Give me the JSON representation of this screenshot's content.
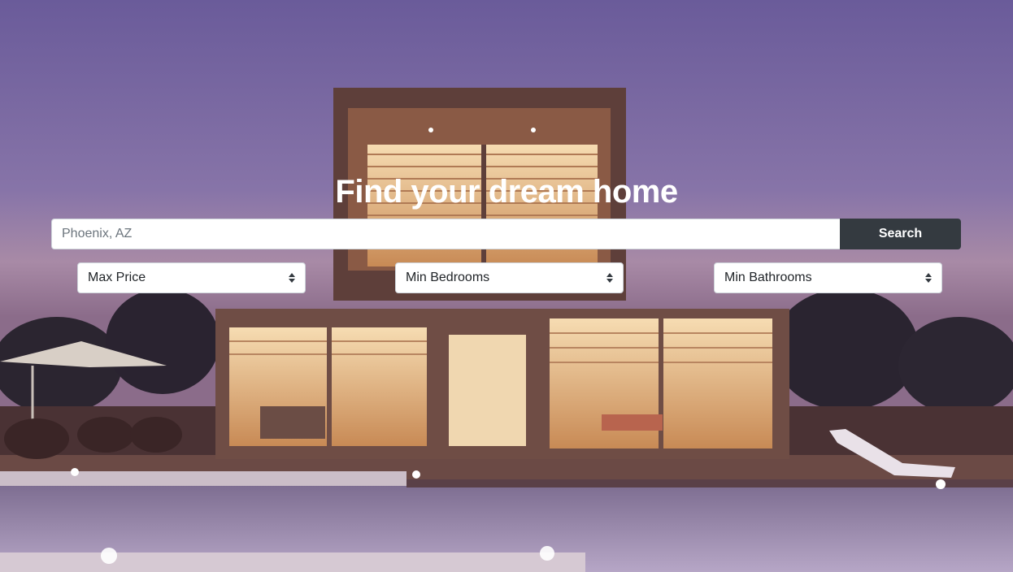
{
  "hero": {
    "headline": "Find your dream home"
  },
  "search": {
    "placeholder": "Phoenix, AZ",
    "button_label": "Search"
  },
  "filters": [
    {
      "label": "Max Price"
    },
    {
      "label": "Min Bedrooms"
    },
    {
      "label": "Min Bathrooms"
    }
  ],
  "colors": {
    "search_button": "#343a40",
    "headline": "#ffffff"
  }
}
